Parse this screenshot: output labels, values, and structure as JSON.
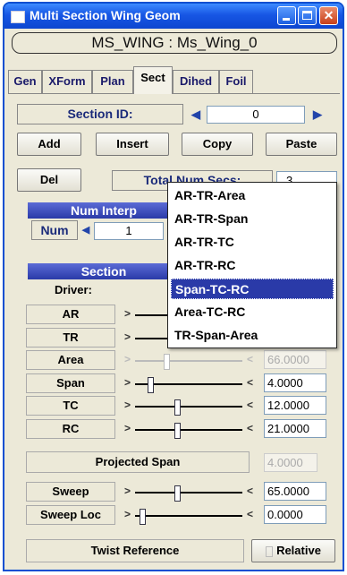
{
  "window": {
    "title": "Multi Section Wing Geom"
  },
  "geom_name": "MS_WING : Ms_Wing_0",
  "tabs": [
    {
      "label": "Gen"
    },
    {
      "label": "XForm"
    },
    {
      "label": "Plan"
    },
    {
      "label": "Sect"
    },
    {
      "label": "Dihed"
    },
    {
      "label": "Foil"
    }
  ],
  "active_tab": "Sect",
  "section": {
    "id_label": "Section ID:",
    "id_value": "0",
    "left_arrow": "◀",
    "right_arrow": "▶"
  },
  "buttons": {
    "add": "Add",
    "insert": "Insert",
    "copy": "Copy",
    "paste": "Paste",
    "del": "Del"
  },
  "total_num_secs": {
    "label": "Total Num Secs:",
    "value": "3"
  },
  "num_interp": {
    "header": "Num Interp",
    "label": "Num",
    "value": "1"
  },
  "section_panel": {
    "header": "Section",
    "driver_label": "Driver:"
  },
  "rows": [
    {
      "label": "AR"
    },
    {
      "label": "TR"
    },
    {
      "label": "Area",
      "value": "66.0000",
      "pos": 0.28,
      "dim": true
    },
    {
      "label": "Span",
      "value": "4.0000",
      "pos": 0.12
    },
    {
      "label": "TC",
      "value": "12.0000",
      "pos": 0.38
    },
    {
      "label": "RC",
      "value": "21.0000",
      "pos": 0.38
    }
  ],
  "projected_span": {
    "label": "Projected Span",
    "value": "4.0000"
  },
  "sweep_rows": [
    {
      "label": "Sweep",
      "value": "65.0000",
      "pos": 0.38
    },
    {
      "label": "Sweep Loc",
      "value": "0.0000",
      "pos": 0.04
    }
  ],
  "twist": {
    "label": "Twist Reference",
    "relative_label": "Relative"
  },
  "driver_menu": {
    "items": [
      {
        "label": "AR-TR-Area"
      },
      {
        "label": "AR-TR-Span"
      },
      {
        "label": "AR-TR-TC"
      },
      {
        "label": "AR-TR-RC"
      },
      {
        "label": "Span-TC-RC"
      },
      {
        "label": "Area-TC-RC"
      },
      {
        "label": "TR-Span-Area"
      }
    ],
    "selected": "Span-TC-RC"
  },
  "colors": {
    "titlebar": "#1756e4",
    "header_blue": "#2a3aa8",
    "selection": "#2a3aa8",
    "close_button": "#c8401a"
  }
}
